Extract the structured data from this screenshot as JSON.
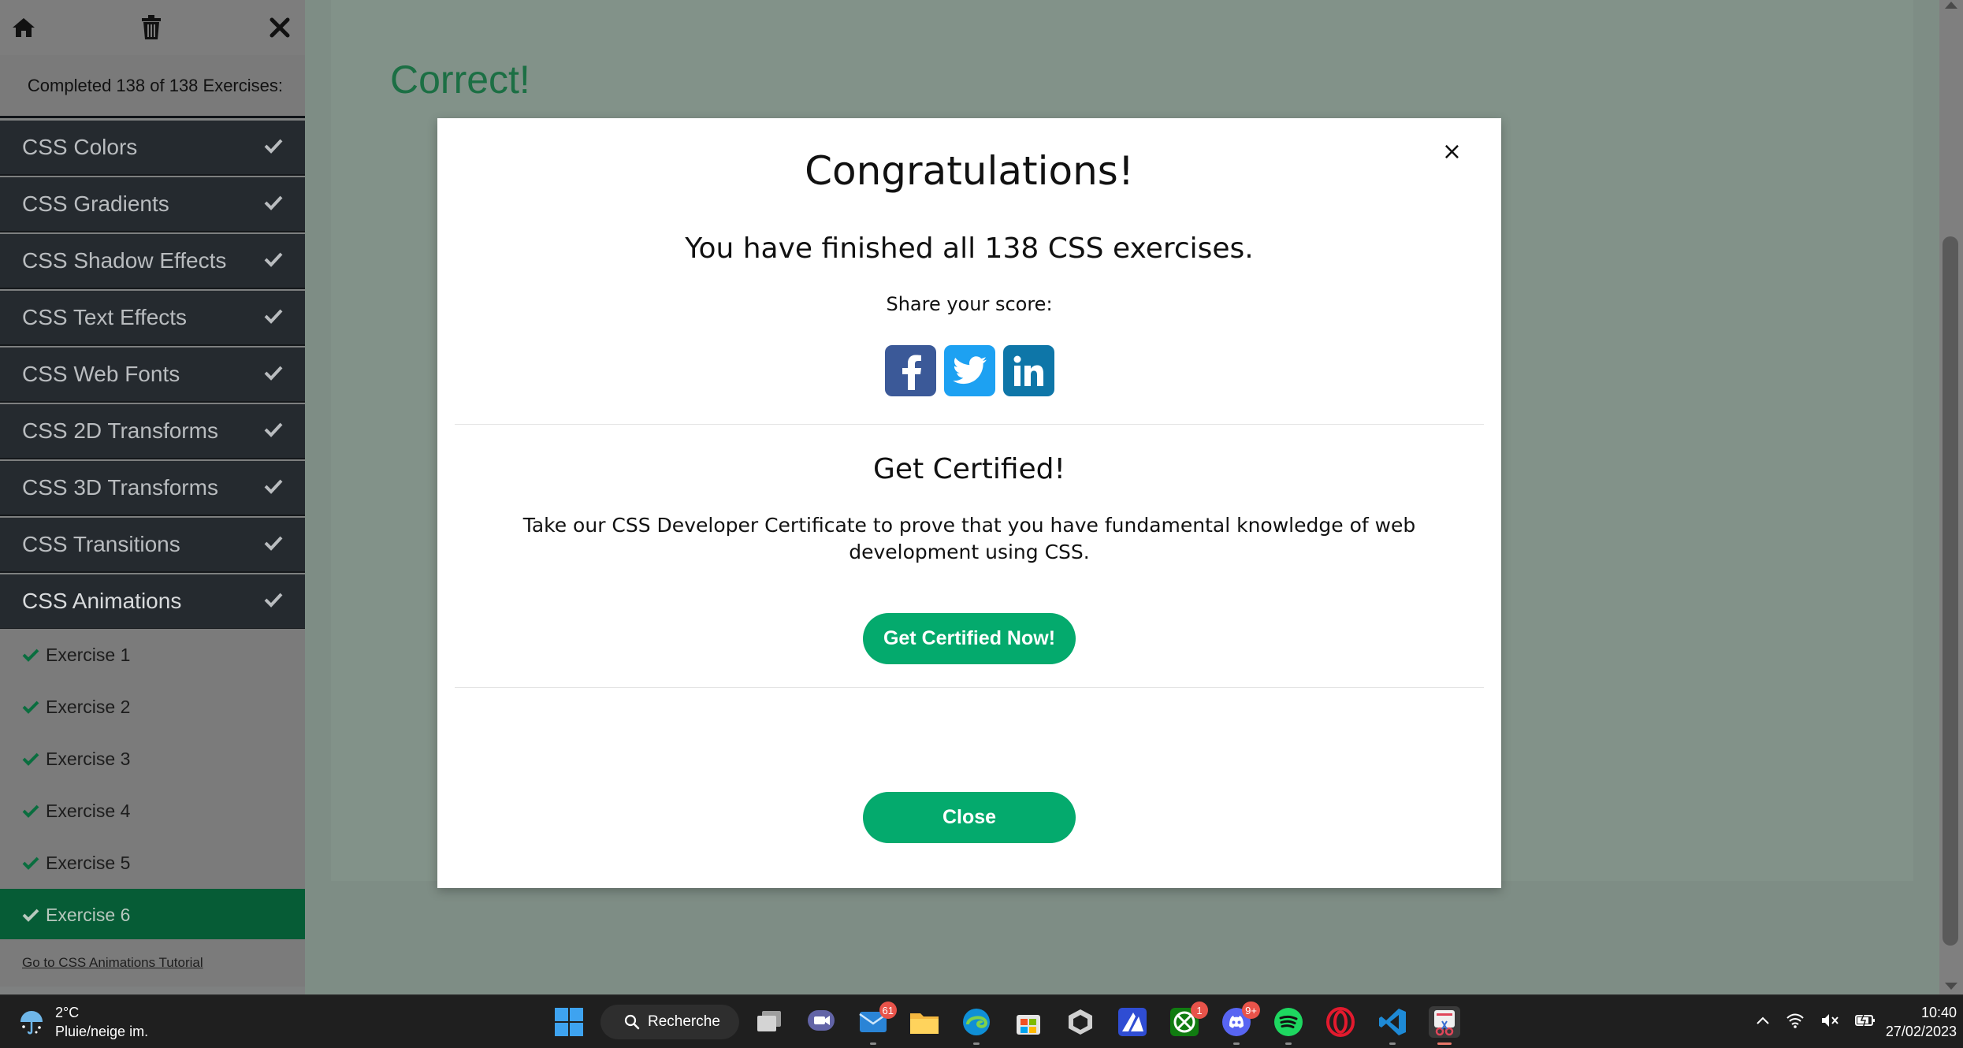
{
  "sidebar": {
    "completed_text": "Completed 138 of 138 Exercises:",
    "sections": [
      {
        "label": "CSS Colors"
      },
      {
        "label": "CSS Gradients"
      },
      {
        "label": "CSS Shadow Effects"
      },
      {
        "label": "CSS Text Effects"
      },
      {
        "label": "CSS Web Fonts"
      },
      {
        "label": "CSS 2D Transforms"
      },
      {
        "label": "CSS 3D Transforms"
      },
      {
        "label": "CSS Transitions"
      },
      {
        "label": "CSS Animations"
      }
    ],
    "exercises": [
      {
        "label": "Exercise 1"
      },
      {
        "label": "Exercise 2"
      },
      {
        "label": "Exercise 3"
      },
      {
        "label": "Exercise 4"
      },
      {
        "label": "Exercise 5"
      },
      {
        "label": "Exercise 6"
      }
    ],
    "footer_link": "Go to CSS Animations Tutorial"
  },
  "main": {
    "result_title": "Correct!"
  },
  "modal": {
    "close_glyph": "×",
    "title": "Congratulations!",
    "subtitle": "You have finished all 138 CSS exercises.",
    "share_label": "Share your score:",
    "cert_title": "Get Certified!",
    "cert_text": "Take our CSS Developer Certificate to prove that you have fundamental knowledge of web development using CSS.",
    "cert_button": "Get Certified Now!",
    "close_button": "Close"
  },
  "taskbar": {
    "weather_temp": "2°C",
    "weather_desc": "Pluie/neige im.",
    "search_label": "Recherche",
    "mail_badge": "61",
    "xbox_badge": "1",
    "discord_badge": "9+",
    "time": "10:40",
    "date": "27/02/2023"
  },
  "colors": {
    "accent_green": "#04aa6d",
    "sidebar_dark": "#252a2f",
    "active_exercise": "#065c36",
    "facebook": "#3b5998",
    "twitter": "#1da1f2",
    "linkedin": "#0e76a8"
  }
}
